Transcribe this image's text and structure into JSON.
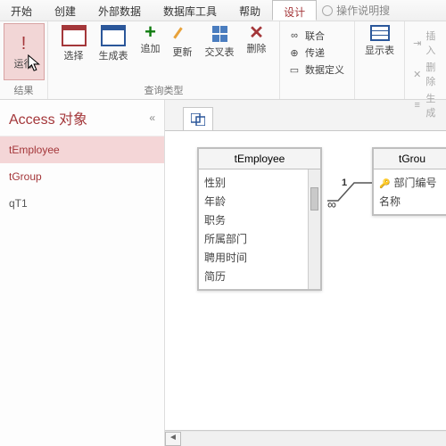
{
  "tabs": {
    "start": "开始",
    "create": "创建",
    "external": "外部数据",
    "dbtools": "数据库工具",
    "help": "帮助",
    "design": "设计",
    "hint": "操作说明搜"
  },
  "ribbon": {
    "run": "运行",
    "select": "选择",
    "maketable": "生成表",
    "append": "追加",
    "update": "更新",
    "crosstab": "交叉表",
    "delete": "删除",
    "union": "联合",
    "passthrough": "传递",
    "datadef": "数据定义",
    "showtable": "显示表",
    "insert": "插入",
    "deleterow": "删除",
    "build": "生成",
    "results_caption": "结果",
    "querytype_caption": "查询类型"
  },
  "nav": {
    "title": "Access 对象",
    "items": [
      "tEmployee",
      "tGroup",
      "qT1"
    ]
  },
  "tables": {
    "t1": {
      "title": "tEmployee",
      "fields": [
        "性别",
        "年龄",
        "职务",
        "所属部门",
        "聘用时间",
        "简历"
      ]
    },
    "t2": {
      "title": "tGrou",
      "fields": [
        "部门编号",
        "名称"
      ]
    }
  },
  "join": {
    "one": "1",
    "many": "∞"
  }
}
